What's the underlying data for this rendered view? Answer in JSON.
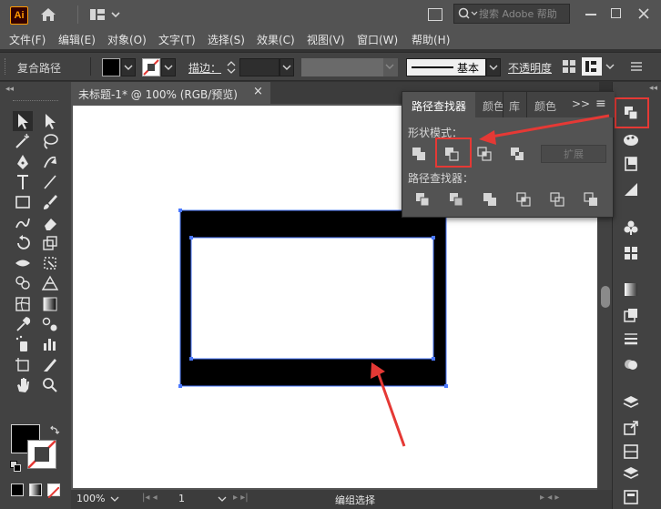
{
  "app": {
    "logo_text": "Ai"
  },
  "topbar": {
    "search_placeholder": "搜索 Adobe 帮助",
    "icons": [
      "home-icon",
      "workspace-grid-icon",
      "window-icon",
      "minimize-icon",
      "restore-icon",
      "close-icon"
    ]
  },
  "menu": {
    "items": [
      "文件(F)",
      "编辑(E)",
      "对象(O)",
      "文字(T)",
      "选择(S)",
      "效果(C)",
      "视图(V)",
      "窗口(W)",
      "帮助(H)"
    ]
  },
  "control_bar": {
    "selection_type": "复合路径",
    "stroke_label": "描边：",
    "stroke_profile": "基本",
    "opacity_label": "不透明度"
  },
  "document": {
    "tab_title": "未标题-1* @ 100% (RGB/预览)",
    "close_symbol": "×"
  },
  "pathfinder_panel": {
    "tabs": [
      "路径查找器",
      "颜色",
      "库",
      "颜色"
    ],
    "shape_modes_label": "形状模式：",
    "pathfinders_label": "路径查找器：",
    "expand_button": "扩展",
    "more_symbol": ">>",
    "menu_symbol": "≡",
    "shape_mode_icons": [
      "unite-icon",
      "minus-front-icon",
      "intersect-icon",
      "exclude-icon"
    ],
    "pathfinder_icons": [
      "divide-icon",
      "trim-icon",
      "merge-icon",
      "crop-icon",
      "outline-icon",
      "minus-back-icon"
    ],
    "highlighted": "minus-front-icon"
  },
  "status_bar": {
    "zoom": "100%",
    "artboard_number": "1",
    "status_text": "编组选择"
  },
  "colors": {
    "accent_red": "#e53935",
    "selection_blue": "#4a78ff",
    "fill_black": "#000000"
  }
}
